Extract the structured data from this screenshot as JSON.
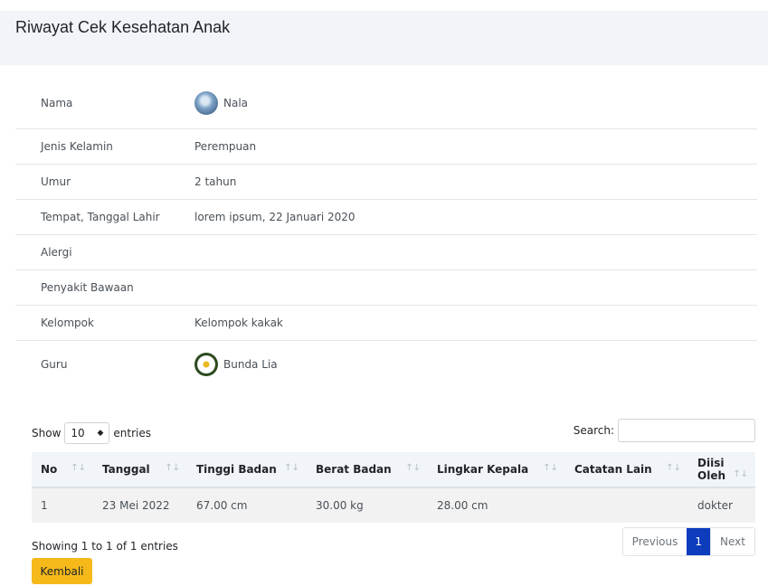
{
  "page": {
    "title": "Riwayat Cek Kesehatan Anak"
  },
  "profile": {
    "rows": [
      {
        "label": "Nama",
        "value": "Nala",
        "avatar": "child-photo"
      },
      {
        "label": "Jenis Kelamin",
        "value": "Perempuan"
      },
      {
        "label": "Umur",
        "value": "2 tahun"
      },
      {
        "label": "Tempat, Tanggal Lahir",
        "value": "lorem ipsum, 22 Januari 2020"
      },
      {
        "label": "Alergi",
        "value": ""
      },
      {
        "label": "Penyakit Bawaan",
        "value": ""
      },
      {
        "label": "Kelompok",
        "value": "Kelompok kakak"
      },
      {
        "label": "Guru",
        "value": "Bunda Lia",
        "avatar": "teacher-photo"
      }
    ]
  },
  "table": {
    "show_label": "Show",
    "entries_value": "10",
    "entries_label": "entries",
    "search_label": "Search:",
    "search_value": "",
    "columns": [
      "No",
      "Tanggal",
      "Tinggi Badan",
      "Berat Badan",
      "Lingkar Kepala",
      "Catatan Lain",
      "Diisi Oleh"
    ],
    "sort_icon": "sort-icon",
    "rows": [
      {
        "no": "1",
        "tanggal": "23 Mei 2022",
        "tinggi": "67.00 cm",
        "berat": "30.00 kg",
        "lingkar": "28.00 cm",
        "catatan": "",
        "diisi": "dokter"
      }
    ],
    "info": "Showing 1 to 1 of 1 entries",
    "pagination": {
      "previous": "Previous",
      "current": "1",
      "next": "Next"
    }
  },
  "actions": {
    "back_label": "Kembali"
  },
  "colors": {
    "header_bg": "#f1f4f9",
    "accent_blue": "#0d3cbd",
    "button_yellow": "#f6b91a"
  }
}
